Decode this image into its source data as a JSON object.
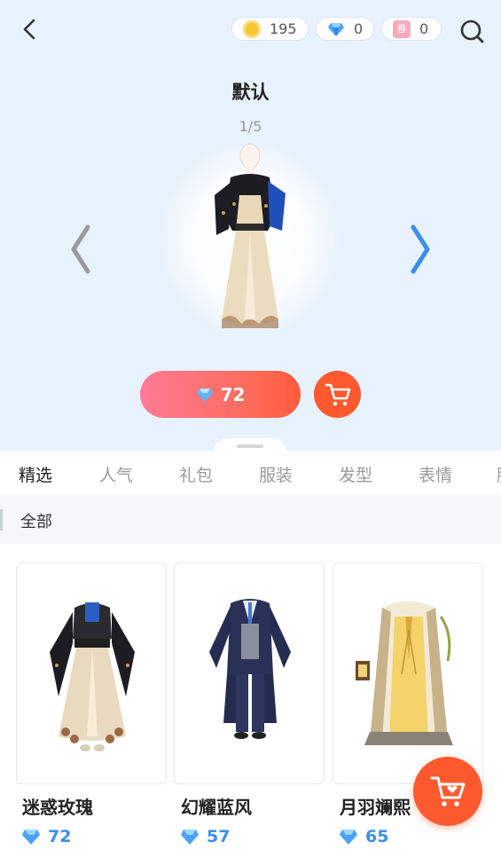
{
  "header": {
    "coins": "195",
    "diamonds": "0",
    "tickets": "0",
    "ticket_glyph": "春",
    "icons": [
      "back-icon",
      "coin-icon",
      "diamond-icon",
      "ticket-icon",
      "search-icon"
    ]
  },
  "outfit": {
    "title": "默认",
    "page": "1/5",
    "price": "72"
  },
  "tabs": [
    "精选",
    "人气",
    "礼包",
    "服装",
    "发型",
    "表情",
    "脸"
  ],
  "filter": {
    "label": "全部"
  },
  "items": [
    {
      "name": "迷惑玫瑰",
      "price": "72"
    },
    {
      "name": "幻耀蓝风",
      "price": "57"
    },
    {
      "name": "月羽斓熙",
      "price": "65"
    }
  ],
  "colors": {
    "accent": "#ff5a2f",
    "diamond": "#3d8fe8",
    "background": "#e8f2fc"
  }
}
